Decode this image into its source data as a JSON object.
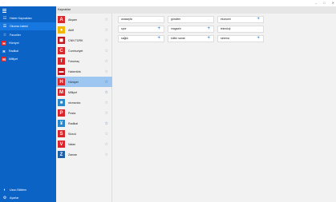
{
  "window": {
    "title": "...",
    "controls": [
      "–",
      "□",
      "✕"
    ]
  },
  "nav": {
    "items": [
      {
        "label": "Haber Kaynakları",
        "icon": "☷"
      },
      {
        "label": "Okuma Listesi",
        "icon": "☰"
      },
      {
        "label": "Favoriler",
        "icon": "☆"
      }
    ],
    "favorite_sites": [
      {
        "label": "Hürriyet",
        "logo": "H",
        "color": "#d9262b"
      },
      {
        "label": "Radikal",
        "logo": "R",
        "color": "#0a65c5"
      },
      {
        "label": "Milliyet",
        "logo": "M",
        "color": "#d9262b"
      }
    ],
    "footer": [
      {
        "label": "Uzun Bildirim",
        "icon": "◐"
      },
      {
        "label": "Ayarlar",
        "icon": "⚙"
      }
    ]
  },
  "header": {
    "title": "Kaynaklar"
  },
  "sites": [
    {
      "label": "Akşam",
      "logo": "A",
      "color": "#d9262b",
      "favorite": false
    },
    {
      "label": "Aktif",
      "logo": "●",
      "color": "#f2b600",
      "favorite": false
    },
    {
      "label": "CNN TÜRK",
      "logo": "◼",
      "color": "#c0181e",
      "favorite": false
    },
    {
      "label": "Cumhuriyet",
      "logo": "C",
      "color": "#d9262b",
      "favorite": false
    },
    {
      "label": "Fotomaç",
      "logo": "f",
      "color": "#d9262b",
      "favorite": false
    },
    {
      "label": "Habertürk",
      "logo": "▬",
      "color": "#c0181e",
      "favorite": false
    },
    {
      "label": "Hürriyet",
      "logo": "H",
      "color": "#d9262b",
      "favorite": true,
      "selected": true
    },
    {
      "label": "Milliyet",
      "logo": "M",
      "color": "#d9262b",
      "favorite": true
    },
    {
      "label": "ntvmsnbc",
      "logo": "■",
      "color": "#2a86c9",
      "favorite": false
    },
    {
      "label": "Posta",
      "logo": "P",
      "color": "#d9262b",
      "favorite": false
    },
    {
      "label": "Radikal",
      "logo": "¥",
      "color": "#2a86c9",
      "favorite": true
    },
    {
      "label": "Sözcü",
      "logo": "S",
      "color": "#d9262b",
      "favorite": false
    },
    {
      "label": "Vatan",
      "logo": "V",
      "color": "#d9262b",
      "favorite": false
    },
    {
      "label": "Zaman",
      "logo": "Z",
      "color": "#1f5fa8",
      "favorite": false
    }
  ],
  "categories": [
    {
      "label": "anasayfa",
      "action": "···"
    },
    {
      "label": "gündem",
      "action": "···"
    },
    {
      "label": "ekonomi",
      "action": "+"
    },
    {
      "label": "spor",
      "action": "+"
    },
    {
      "label": "magazin",
      "action": "+"
    },
    {
      "label": "teknoloji",
      "action": "···"
    },
    {
      "label": "sağlık",
      "action": "+"
    },
    {
      "label": "kültür sanat",
      "action": "+"
    },
    {
      "label": "sinema",
      "action": "+"
    }
  ]
}
